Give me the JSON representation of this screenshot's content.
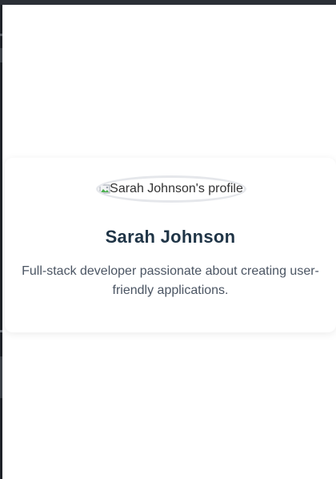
{
  "profile": {
    "avatar_alt": "Sarah Johnson's profile",
    "name": "Sarah Johnson",
    "bio": "Full-stack developer passionate about creating user-friendly applications."
  },
  "icons": {
    "avatar_placeholder": "broken-image-icon"
  },
  "colors": {
    "name_text": "#1f3446",
    "bio_text": "#4b5563",
    "card_background": "#ffffff",
    "avatar_border": "#e5e7eb"
  }
}
